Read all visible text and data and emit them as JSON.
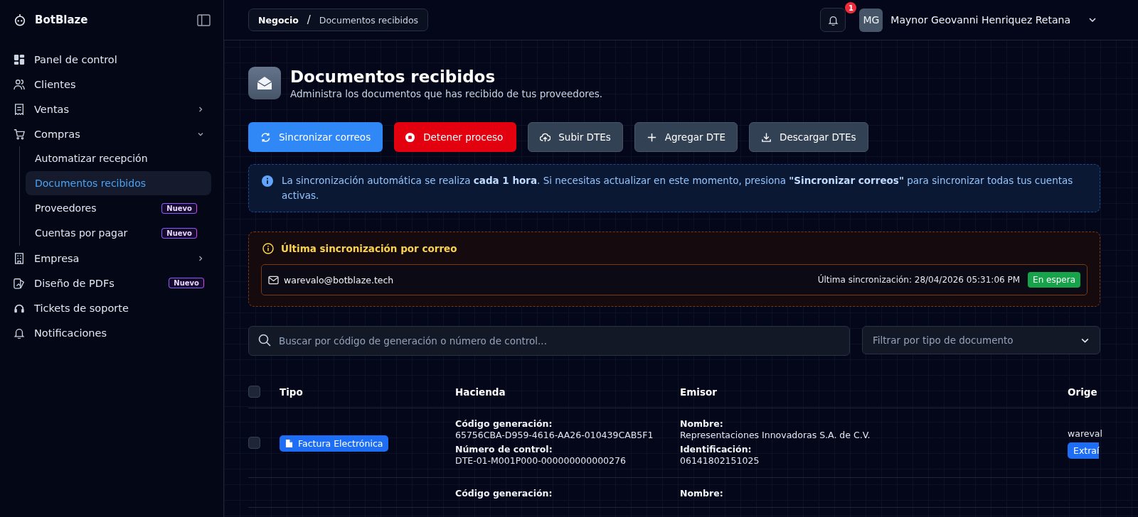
{
  "sidebar": {
    "brand": "BotBlaze",
    "items": [
      {
        "label": "Panel de control",
        "kind": "link"
      },
      {
        "label": "Clientes",
        "kind": "link"
      },
      {
        "label": "Ventas",
        "kind": "group",
        "expanded": false
      },
      {
        "label": "Compras",
        "kind": "group",
        "expanded": true,
        "children": [
          {
            "label": "Automatizar recepción",
            "selected": false
          },
          {
            "label": "Documentos recibidos",
            "selected": true
          },
          {
            "label": "Proveedores",
            "selected": false,
            "badge": "Nuevo"
          },
          {
            "label": "Cuentas por pagar",
            "selected": false,
            "badge": "Nuevo"
          }
        ]
      },
      {
        "label": "Empresa",
        "kind": "group",
        "expanded": false
      },
      {
        "label": "Diseño de PDFs",
        "kind": "link",
        "badge": "Nuevo"
      },
      {
        "label": "Tickets de soporte",
        "kind": "link"
      },
      {
        "label": "Notificaciones",
        "kind": "link"
      }
    ]
  },
  "breadcrumb": {
    "separator": "/",
    "items": [
      "Negocio",
      "Documentos recibidos"
    ]
  },
  "notifications": {
    "count": "1"
  },
  "user": {
    "initials": "MG",
    "name": "Maynor Geovanni Henriquez Retana"
  },
  "header": {
    "title": "Documentos recibidos",
    "subtitle": "Administra los documentos que has recibido de tus proveedores."
  },
  "actions": [
    {
      "label": "Sincronizar correos",
      "kind": "primary"
    },
    {
      "label": "Detener proceso",
      "kind": "danger"
    },
    {
      "label": "Subir DTEs",
      "kind": "secondary"
    },
    {
      "label": "Agregar DTE",
      "kind": "secondary"
    },
    {
      "label": "Descargar DTEs",
      "kind": "secondary"
    }
  ],
  "info_banner": {
    "text": "La sincronización automática se realiza **cada 1 hora**. Si necesitas actualizar en este momento, presiona **\"Sincronizar correos\"** para sincronizar todas tus cuentas activas."
  },
  "last_sync": {
    "title": "Última sincronización por correo",
    "accounts": [
      {
        "email": "warevalo@botblaze.tech",
        "time": "Última sincronización: 28/04/2026 05:31:06 PM",
        "status": "En espera"
      }
    ]
  },
  "search": {
    "placeholder": "Buscar por código de generación o número de control..."
  },
  "filter": {
    "placeholder": "Filtrar por tipo de documento"
  },
  "table": {
    "select_all": {
      "checked": false
    },
    "columns": [
      "Tipo",
      "Hacienda",
      "Emisor",
      "Orige"
    ],
    "rows": [
      {
        "checked": false,
        "type": "Factura Electrónica",
        "hacienda": [
          {
            "label": "Código generación:",
            "value": "65756CBA-D959-4616-AA26-010439CAB5F1"
          },
          {
            "label": "Número de control:",
            "value": "DTE-01-M001P000-000000000000276"
          }
        ],
        "emisor": [
          {
            "label": "Nombre:",
            "value": "Representaciones Innovadoras S.A. de C.V."
          },
          {
            "label": "Identificación:",
            "value": "06141802151025"
          }
        ],
        "origin": {
          "email": "wareval",
          "badge": "Extraí"
        }
      },
      {
        "hacienda": [
          {
            "label": "Código generación:"
          }
        ],
        "emisor": [
          {
            "label": "Nombre:"
          }
        ]
      }
    ]
  }
}
